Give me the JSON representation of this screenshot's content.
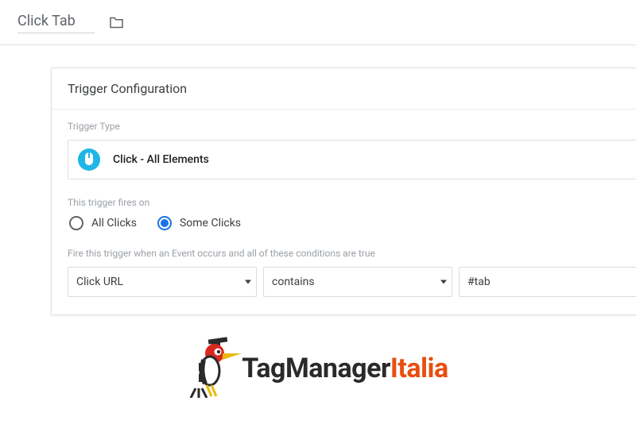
{
  "header": {
    "trigger_name": "Click Tab"
  },
  "panel": {
    "title": "Trigger Configuration",
    "trigger_type_label": "Trigger Type",
    "trigger_type_value": "Click - All Elements",
    "fires_on_label": "This trigger fires on",
    "radio_all": "All Clicks",
    "radio_some": "Some Clicks",
    "condition_label": "Fire this trigger when an Event occurs and all of these conditions are true",
    "var_select": "Click URL",
    "op_select": "contains",
    "value_input": "#tab"
  },
  "logo": {
    "text1": "TagManager",
    "text2": "Italia"
  }
}
